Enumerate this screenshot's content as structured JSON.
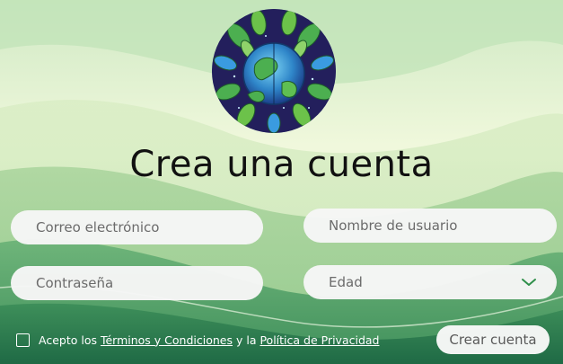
{
  "title": "Crea una cuenta",
  "form": {
    "email_placeholder": "Correo electrónico",
    "username_placeholder": "Nombre de usuario",
    "password_placeholder": "Contraseña",
    "age_selected": "Edad"
  },
  "footer": {
    "accept_prefix": "Acepto los ",
    "terms_link": "Términos y Condiciones",
    "connector": " y la ",
    "privacy_link": "Política de Privacidad"
  },
  "submit_label": "Crear cuenta",
  "icons": {
    "logo": "earth-leaves-logo-icon",
    "select_arrow": "chevron-down-icon",
    "checkbox": "checkbox-icon"
  },
  "colors": {
    "accent": "#2f8f4a",
    "field_bg": "#f6f6f6",
    "title": "#111111"
  },
  "checkbox_checked": false
}
